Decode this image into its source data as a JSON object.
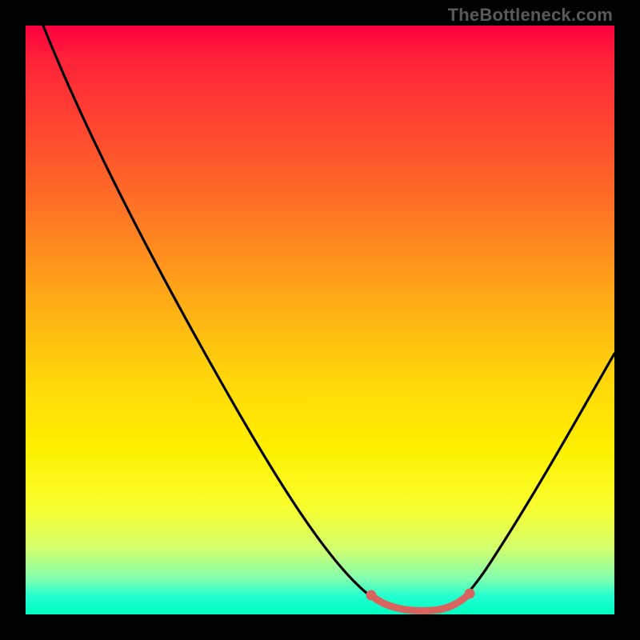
{
  "attribution": "TheBottleneck.com",
  "chart_data": {
    "type": "line",
    "title": "",
    "xlabel": "",
    "ylabel": "",
    "ylim": [
      0,
      100
    ],
    "xlim": [
      0,
      100
    ],
    "series": [
      {
        "name": "main-curve",
        "points": [
          {
            "x": 3,
            "y": 100
          },
          {
            "x": 12,
            "y": 82
          },
          {
            "x": 24,
            "y": 60
          },
          {
            "x": 36,
            "y": 38
          },
          {
            "x": 48,
            "y": 18
          },
          {
            "x": 56,
            "y": 6
          },
          {
            "x": 60,
            "y": 2
          },
          {
            "x": 64,
            "y": 0.5
          },
          {
            "x": 70,
            "y": 0.5
          },
          {
            "x": 74,
            "y": 2
          },
          {
            "x": 80,
            "y": 10
          },
          {
            "x": 88,
            "y": 25
          },
          {
            "x": 96,
            "y": 42
          },
          {
            "x": 100,
            "y": 50
          }
        ]
      },
      {
        "name": "highlight-segment",
        "points": [
          {
            "x": 60,
            "y": 2
          },
          {
            "x": 62,
            "y": 1
          },
          {
            "x": 66,
            "y": 0.5
          },
          {
            "x": 70,
            "y": 0.5
          },
          {
            "x": 73,
            "y": 1.5
          },
          {
            "x": 75,
            "y": 3
          }
        ]
      }
    ],
    "highlight_color": "#d9635e",
    "curve_color": "#000000"
  }
}
